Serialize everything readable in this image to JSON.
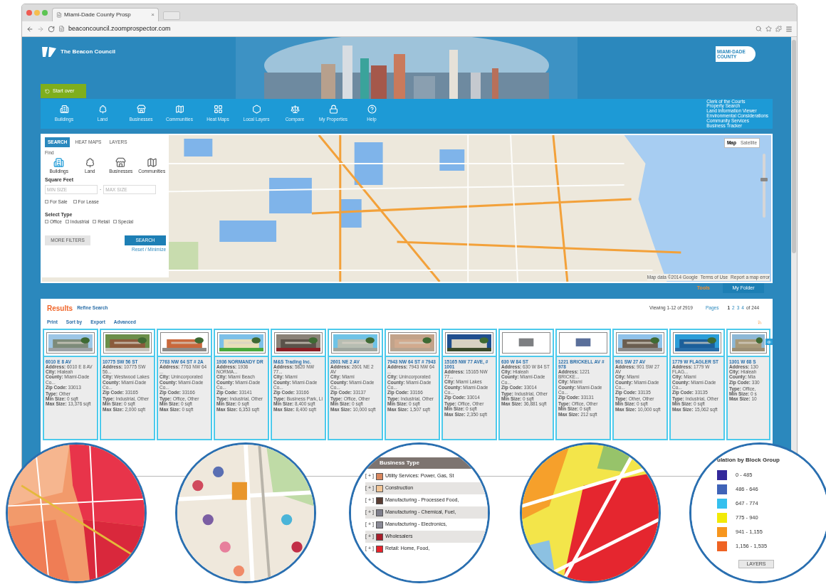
{
  "browser": {
    "tab_title": "Miami-Dade County Prosp",
    "tab_close": "×",
    "url": "beaconcouncil.zoomprospector.com"
  },
  "header": {
    "logo_text": "The Beacon Council",
    "county_logo": [
      "MIAMI·DADE",
      "COUNTY"
    ],
    "start_over": "Start over"
  },
  "nav": {
    "items": [
      {
        "kind": "building",
        "label": "Buildings"
      },
      {
        "kind": "land",
        "label": "Land"
      },
      {
        "kind": "business",
        "label": "Businesses"
      },
      {
        "kind": "community",
        "label": "Communities"
      },
      {
        "kind": "heatmap",
        "label": "Heat Maps"
      },
      {
        "kind": "layers",
        "label": "Local Layers"
      },
      {
        "kind": "compare",
        "label": "Compare"
      },
      {
        "kind": "lock",
        "label": "My Properties"
      },
      {
        "kind": "help",
        "label": "Help"
      }
    ],
    "links": [
      "Clerk of the Courts",
      "Property Search",
      "Land Information Viewer",
      "Environmental Considerations",
      "Community Services",
      "Business Tracker"
    ]
  },
  "search_panel": {
    "tabs": [
      {
        "label": "SEARCH",
        "selected": true
      },
      {
        "label": "HEAT MAPS",
        "selected": false
      },
      {
        "label": "LAYERS",
        "selected": false
      }
    ],
    "find_label": "Find",
    "find_options": [
      {
        "kind": "building",
        "label": "Buildings",
        "selected": true
      },
      {
        "kind": "land",
        "label": "Land",
        "selected": false
      },
      {
        "kind": "business",
        "label": "Businesses",
        "selected": false
      },
      {
        "kind": "community",
        "label": "Communities",
        "selected": false
      }
    ],
    "square_feet_label": "Square Feet",
    "min_placeholder": "MIN SIZE",
    "range_dash": "-",
    "max_placeholder": "MAX SIZE",
    "listing": [
      {
        "label": "For Sale",
        "checked": false
      },
      {
        "label": "For Lease",
        "checked": false
      }
    ],
    "select_type_label": "Select Type",
    "types": [
      {
        "label": "Office",
        "checked": false
      },
      {
        "label": "Industrial",
        "checked": false
      },
      {
        "label": "Retail",
        "checked": false
      },
      {
        "label": "Special",
        "checked": false
      }
    ],
    "more_filters": "MORE FILTERS",
    "search_button": "SEARCH",
    "reset_link": "Reset / Minimize"
  },
  "map": {
    "zoom": {
      "level": 0.6
    },
    "type_buttons": [
      {
        "label": "Map",
        "selected": true
      },
      {
        "label": "Satellite",
        "selected": false
      }
    ],
    "attribution": [
      "Map data ©2014 Google",
      "Terms of Use",
      "Report a map error"
    ]
  },
  "tools": {
    "label": "Tools",
    "folder": "My Folder"
  },
  "results": {
    "title": "Results",
    "refine": "Refine Search",
    "viewing": "Viewing 1-12 of 2919",
    "pages_label": "Pages",
    "pages": [
      {
        "label": "1",
        "selected": true
      },
      {
        "label": "2",
        "selected": false
      },
      {
        "label": "3",
        "selected": false
      },
      {
        "label": "4",
        "selected": false
      }
    ],
    "pages_total": "of 244",
    "actions": [
      "Print",
      "Sort by",
      "Export",
      "Advanced"
    ],
    "cards": [
      {
        "title": "6010 E 8 AV",
        "details": [
          "**Address:** 6010 E 8 AV",
          "**City:** Hialeah",
          "**County:** Miami-Dade Co...",
          "**Zip Code:** 33013"
        ],
        "sizes": [
          "**Type:** Other",
          "**Min Size:** 0 sqft",
          "**Max Size:** 13,376 sqft"
        ]
      },
      {
        "title": "10775 SW 56 ST",
        "details": [
          "**Address:** 10775 SW 56...",
          "**City:** Westwood Lakes",
          "**County:** Miami-Dade Co...",
          "**Zip Code:** 33165"
        ],
        "sizes": [
          "**Type:** Industrial, Other",
          "**Min Size:** 0 sqft",
          "**Max Size:** 2,000 sqft"
        ]
      },
      {
        "title": "7763 NW 64 ST # 2A",
        "details": [
          "**Address:** 7763 NW 64 ...",
          "**City:** Unincorporated",
          "**County:** Miami-Dade Co...",
          "**Zip Code:** 33166"
        ],
        "sizes": [
          "**Type:** Office, Other",
          "**Min Size:** 0 sqft",
          "**Max Size:** 0 sqft"
        ]
      },
      {
        "title": "1936 NORMANDY DR",
        "details": [
          "**Address:** 1936 NORMA...",
          "**City:** Miami Beach",
          "**County:** Miami-Dade Co...",
          "**Zip Code:** 33141"
        ],
        "sizes": [
          "**Type:** Industrial, Other",
          "**Min Size:** 0 sqft",
          "**Max Size:** 6,353 sqft"
        ]
      },
      {
        "title": "M&S Trading Inc.",
        "details": [
          "**Address:** 5820 NW 77...",
          "**City:** Miami",
          "**County:** Miami-Dade Co...",
          "**Zip Code:** 33166"
        ],
        "sizes": [
          "**Type:** Business Park, Li",
          "**Min Size:** 8,400 sqft",
          "**Max Size:** 8,400 sqft"
        ]
      },
      {
        "title": "2601 NE 2 AV",
        "details": [
          "**Address:** 2601 NE 2 AV",
          "**City:** Miami",
          "**County:** Miami-Dade Co...",
          "**Zip Code:** 33137"
        ],
        "sizes": [
          "**Type:** Office, Other",
          "**Min Size:** 0 sqft",
          "**Max Size:** 10,000 sqft"
        ]
      },
      {
        "title": "7943 NW 64 ST # 7943",
        "details": [
          "**Address:** 7943 NW 64 ...",
          "**City:** Unincorporated",
          "**County:** Miami-Dade Co...",
          "**Zip Code:** 33166"
        ],
        "sizes": [
          "**Type:** Industrial, Other",
          "**Min Size:** 0 sqft",
          "**Max Size:** 1,507 sqft"
        ]
      },
      {
        "title": "15165 NW 77 AVE, # 1001",
        "details": [
          "**Address:** 15165 NW 77...",
          "**City:** Miami Lakes",
          "**County:** Miami-Dade Co...",
          "**Zip Code:** 33014"
        ],
        "sizes": [
          "**Type:** Office, Other",
          "**Min Size:** 0 sqft",
          "**Max Size:** 2,350 sqft"
        ]
      },
      {
        "title": "630 W 84 ST",
        "details": [
          "**Address:** 630 W 84 ST",
          "**City:** Hialeah",
          "**County:** Miami-Dade Co...",
          "**Zip Code:** 33014"
        ],
        "sizes": [
          "**Type:** Industrial, Other",
          "**Min Size:** 0 sqft",
          "**Max Size:** 36,881 sqft"
        ]
      },
      {
        "title": "1221 BRICKELL AV # 978",
        "details": [
          "**Address:** 1221 BRICKE...",
          "**City:** Miami",
          "**County:** Miami-Dade Co...",
          "**Zip Code:** 33131"
        ],
        "sizes": [
          "**Type:** Office, Other",
          "**Min Size:** 0 sqft",
          "**Max Size:** 212 sqft"
        ]
      },
      {
        "title": "901 SW 27 AV",
        "details": [
          "**Address:** 901 SW 27 AV",
          "**City:** Miami",
          "**County:** Miami-Dade Co...",
          "**Zip Code:** 33135"
        ],
        "sizes": [
          "**Type:** Other, Other",
          "**Min Size:** 0 sqft",
          "**Max Size:** 10,000 sqft"
        ]
      },
      {
        "title": "1779 W FLAGLER ST",
        "details": [
          "**Address:** 1779 W FLAG...",
          "**City:** Miami",
          "**County:** Miami-Dade Co...",
          "**Zip Code:** 33135"
        ],
        "sizes": [
          "**Type:** Industrial, Other",
          "**Min Size:** 0 sqft",
          "**Max Size:** 15,062 sqft"
        ]
      },
      {
        "title": "1301 W 68 S",
        "details": [
          "**Address:** 130",
          "**City:** Hialeah",
          "**County:** Mia",
          "**Zip Code:** 330"
        ],
        "sizes": [
          "**Type:** Office,",
          "**Min Size:** 0 s",
          "**Max Size:** 10"
        ]
      }
    ]
  },
  "insets": [
    {
      "kind": "picture"
    },
    {
      "kind": "picture"
    },
    {
      "kind": "business_legend",
      "title": "Business Type",
      "rows": [
        {
          "toggle": "[ + ]",
          "color": "#d9875e",
          "label": "Utility Services: Power, Gas, St"
        },
        {
          "toggle": "[ + ]",
          "color": "#f2c596",
          "label": "Construction"
        },
        {
          "toggle": "[ + ]",
          "color": "#5a3d33",
          "label": "Manufacturing - Processed Food,"
        },
        {
          "toggle": "[ + ]",
          "color": "#7f7f8c",
          "label": "Manufacturing - Chemical, Fuel,"
        },
        {
          "toggle": "[ + ]",
          "color": "#8a8a96",
          "label": "Manufacturing - Electronics,"
        },
        {
          "toggle": "[ + ]",
          "color": "#a91d2a",
          "label": "Wholesalers"
        },
        {
          "toggle": "[ + ]",
          "color": "#e8232b",
          "label": "Retail: Home, Food,"
        }
      ]
    },
    {
      "kind": "picture"
    },
    {
      "kind": "population_legend",
      "title": "ulation by Block Group",
      "rows": [
        {
          "color": "#33289a",
          "label": "0 - 485"
        },
        {
          "color": "#3f63b8",
          "label": "486 - 646"
        },
        {
          "color": "#35c0ee",
          "label": "647 - 774"
        },
        {
          "color": "#f2ea07",
          "label": "775 - 940"
        },
        {
          "color": "#f7961e",
          "label": "941 - 1,155"
        },
        {
          "color": "#ef6323",
          "label": "1,156 - 1,535"
        }
      ],
      "button": "LAYERS"
    }
  ]
}
